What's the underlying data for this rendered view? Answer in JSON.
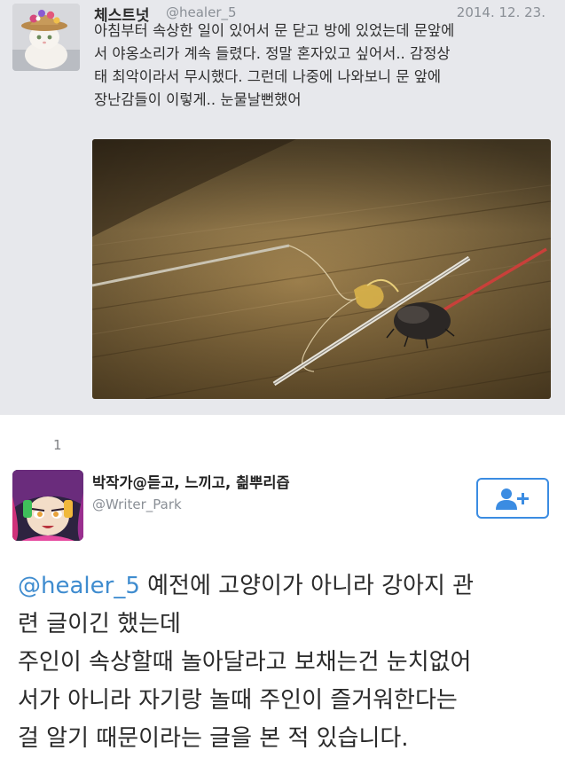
{
  "tweet_original": {
    "display_name": "체스트넛",
    "handle": "@healer_5",
    "date": "2014. 12. 23.",
    "text_lines": [
      "아침부터 속상한 일이 있어서 문 닫고 방에 있었는데 문앞에",
      "서 야옹소리가 계속 들렸다. 정말 혼자있고 싶어서.. 감정상",
      "태 최악이라서 무시했다. 그런데 나중에 나와보니 문 앞에",
      "장난감들이 이렇게.. 눈물날뻔했어"
    ],
    "avatar_icon": "cat-with-flower-hat-avatar",
    "photo_icon": "cat-toys-on-wooden-floor-photo"
  },
  "tweet_reply": {
    "reply_marker": "1",
    "display_name": "박작가@듣고, 느끼고, 칆뿌리즙",
    "handle": "@Writer_Park",
    "follow_icon": "add-user-icon",
    "mention": "@healer_5",
    "text_first_line_rest": " 예전에 고양이가 아니라 강아지 관",
    "text_lines": [
      "련 글이긴 했는데",
      "주인이 속상할때 놀아달라고 보채는건 눈치없어",
      "서가 아니라 자기랑 놀때 주인이 즐거워한다는",
      "걸 알기 때문이라는 글을 본 적 있습니다."
    ],
    "avatar_icon": "anime-character-avatar"
  },
  "colors": {
    "top_background": "#e7e8ec",
    "mention": "#3f8ccf",
    "follow_border": "#3b8ce2"
  }
}
